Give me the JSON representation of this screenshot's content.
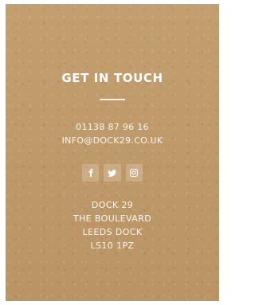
{
  "contact_card": {
    "title": "GET IN TOUCH",
    "phone": "01138 87 96 16",
    "email": "INFO@DOCK29.CO.UK",
    "social": [
      {
        "name": "facebook",
        "glyph": "f"
      },
      {
        "name": "twitter",
        "glyph": ""
      },
      {
        "name": "instagram",
        "glyph": ""
      }
    ],
    "address": [
      "DOCK 29",
      "THE BOULEVARD",
      "LEEDS DOCK",
      "LS10 1PZ"
    ]
  },
  "colors": {
    "background": "#c19a68",
    "text": "#fbf6ef"
  }
}
